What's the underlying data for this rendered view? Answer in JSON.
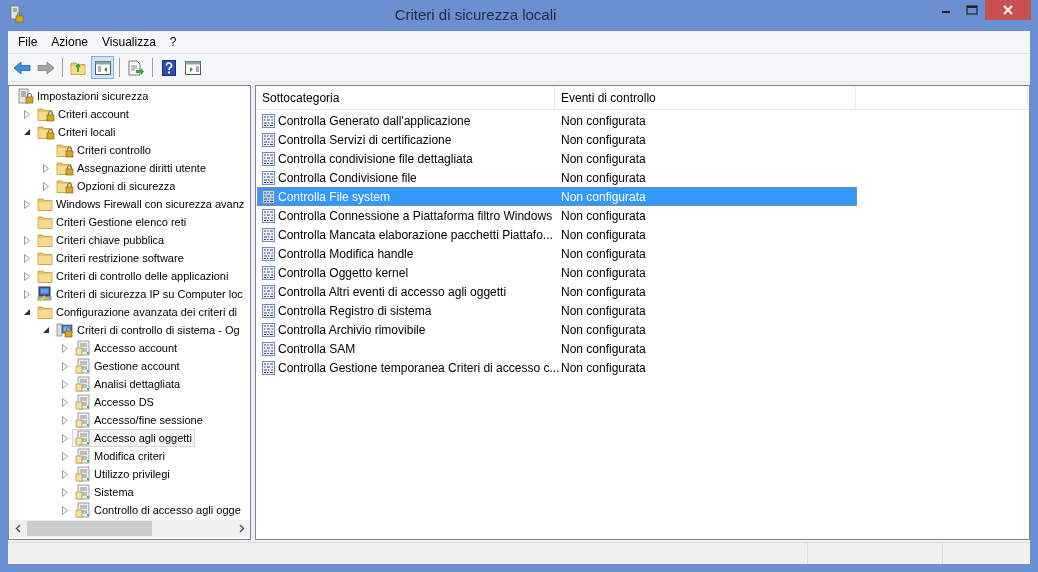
{
  "window": {
    "title": "Criteri di sicurezza locali"
  },
  "menu": [
    "File",
    "Azione",
    "Visualizza",
    "?"
  ],
  "toolbar": [
    [
      {
        "kind": "back",
        "disabled": false,
        "pressed": false
      },
      {
        "kind": "forward",
        "disabled": true,
        "pressed": false
      }
    ],
    [
      {
        "kind": "up-folder",
        "disabled": false,
        "pressed": false
      },
      {
        "kind": "tree-pane",
        "disabled": false,
        "pressed": true
      }
    ],
    [
      {
        "kind": "export",
        "disabled": false,
        "pressed": false
      }
    ],
    [
      {
        "kind": "help",
        "disabled": false,
        "pressed": false
      },
      {
        "kind": "action-pane",
        "disabled": false,
        "pressed": false
      }
    ]
  ],
  "tree": [
    {
      "label": "Impostazioni sicurezza",
      "kind": "policy-root",
      "selected": false,
      "children": [
        {
          "label": "Criteri account",
          "kind": "lock-folder",
          "expanded": false,
          "selected": false
        },
        {
          "label": "Criteri locali",
          "kind": "lock-folder",
          "expanded": true,
          "selected": false,
          "children": [
            {
              "label": "Criteri controllo",
              "kind": "lock-folder",
              "selected": false
            },
            {
              "label": "Assegnazione diritti utente",
              "kind": "lock-folder",
              "expanded": false,
              "selected": false
            },
            {
              "label": "Opzioni di sicurezza",
              "kind": "lock-folder",
              "expanded": false,
              "selected": false
            }
          ]
        },
        {
          "label": "Windows Firewall con sicurezza avanz",
          "kind": "folder",
          "expanded": false,
          "selected": false
        },
        {
          "label": "Criteri Gestione elenco reti",
          "kind": "folder",
          "selected": false
        },
        {
          "label": "Criteri chiave pubblica",
          "kind": "folder",
          "expanded": false,
          "selected": false
        },
        {
          "label": "Criteri restrizione software",
          "kind": "folder",
          "expanded": false,
          "selected": false
        },
        {
          "label": "Criteri di controllo delle applicazioni",
          "kind": "folder",
          "expanded": false,
          "selected": false
        },
        {
          "label": "Criteri di sicurezza IP su Computer loc",
          "kind": "ip-security",
          "expanded": false,
          "selected": false
        },
        {
          "label": "Configurazione avanzata dei criteri di",
          "kind": "folder",
          "expanded": true,
          "selected": false,
          "children": [
            {
              "label": "Criteri di controllo di sistema - Og",
              "kind": "audit-computer",
              "expanded": true,
              "selected": false,
              "children": [
                {
                  "label": "Accesso account",
                  "kind": "audit-category",
                  "expanded": false,
                  "selected": false
                },
                {
                  "label": "Gestione account",
                  "kind": "audit-category",
                  "expanded": false,
                  "selected": false
                },
                {
                  "label": "Analisi dettagliata",
                  "kind": "audit-category",
                  "expanded": false,
                  "selected": false
                },
                {
                  "label": "Accesso DS",
                  "kind": "audit-category",
                  "expanded": false,
                  "selected": false
                },
                {
                  "label": "Accesso/fine sessione",
                  "kind": "audit-category",
                  "expanded": false,
                  "selected": false
                },
                {
                  "label": "Accesso agli oggetti",
                  "kind": "audit-category",
                  "expanded": false,
                  "selected": true
                },
                {
                  "label": "Modifica criteri",
                  "kind": "audit-category",
                  "expanded": false,
                  "selected": false
                },
                {
                  "label": "Utilizzo privilegi",
                  "kind": "audit-category",
                  "expanded": false,
                  "selected": false
                },
                {
                  "label": "Sistema",
                  "kind": "audit-category",
                  "expanded": false,
                  "selected": false
                },
                {
                  "label": "Controllo di accesso agli ogge",
                  "kind": "audit-category",
                  "expanded": false,
                  "selected": false
                }
              ]
            }
          ]
        }
      ]
    }
  ],
  "table": {
    "columns": [
      "Sottocategoria",
      "Eventi di controllo"
    ],
    "rows": [
      {
        "cells": [
          "Controlla Generato dall'applicazione",
          "Non configurata"
        ],
        "selected": false
      },
      {
        "cells": [
          "Controlla Servizi di certificazione",
          "Non configurata"
        ],
        "selected": false
      },
      {
        "cells": [
          "Controlla condivisione file dettagliata",
          "Non configurata"
        ],
        "selected": false
      },
      {
        "cells": [
          "Controlla Condivisione file",
          "Non configurata"
        ],
        "selected": false
      },
      {
        "cells": [
          "Controlla File system",
          "Non configurata"
        ],
        "selected": true
      },
      {
        "cells": [
          "Controlla Connessione a Piattaforma filtro Windows",
          "Non configurata"
        ],
        "selected": false
      },
      {
        "cells": [
          "Controlla Mancata elaborazione pacchetti Piattafo...",
          "Non configurata"
        ],
        "selected": false
      },
      {
        "cells": [
          "Controlla Modifica handle",
          "Non configurata"
        ],
        "selected": false
      },
      {
        "cells": [
          "Controlla Oggetto kernel",
          "Non configurata"
        ],
        "selected": false
      },
      {
        "cells": [
          "Controlla Altri eventi di accesso agli oggetti",
          "Non configurata"
        ],
        "selected": false
      },
      {
        "cells": [
          "Controlla Registro di sistema",
          "Non configurata"
        ],
        "selected": false
      },
      {
        "cells": [
          "Controlla Archivio rimovibile",
          "Non configurata"
        ],
        "selected": false
      },
      {
        "cells": [
          "Controlla SAM",
          "Non configurata"
        ],
        "selected": false
      },
      {
        "cells": [
          "Controlla Gestione temporanea Criteri di accesso c...",
          "Non configurata"
        ],
        "selected": false
      }
    ]
  }
}
